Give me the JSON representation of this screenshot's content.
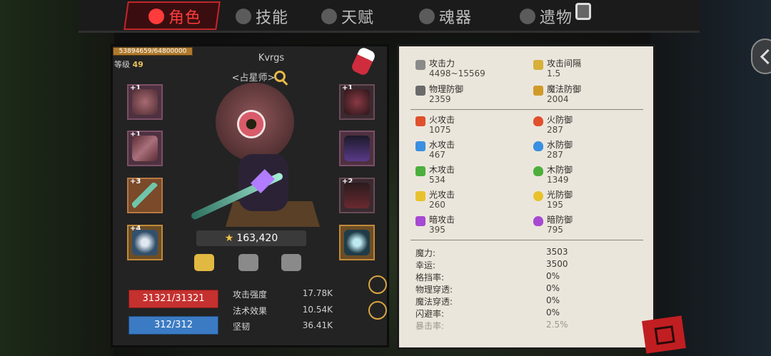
{
  "tabs": [
    {
      "label": "角色",
      "active": true,
      "icon": "demon-face-icon"
    },
    {
      "label": "技能",
      "active": false,
      "icon": "swirl-icon"
    },
    {
      "label": "天赋",
      "active": false,
      "icon": "wings-icon"
    },
    {
      "label": "魂器",
      "active": false,
      "icon": "soul-icon"
    },
    {
      "label": "遗物",
      "active": false,
      "icon": "relic-icon"
    }
  ],
  "character": {
    "xp": "53894659/64800000",
    "xp_fraction": 0.832,
    "level_label": "等级",
    "level": "49",
    "name": "Kvrgs",
    "class": "<占星师>",
    "power": "163,420",
    "hp": "31321/31321",
    "mp": "312/312"
  },
  "equipment_slots": [
    {
      "plus": "+1",
      "item": "bear-head-helmet"
    },
    {
      "plus": "+1",
      "item": "bone-gauntlet"
    },
    {
      "plus": "+3",
      "item": "jade-blade"
    },
    {
      "plus": "+4",
      "item": "skull-amulet"
    },
    {
      "plus": "+1",
      "item": "claw-bracer"
    },
    {
      "plus": "",
      "item": "crystal-armor"
    },
    {
      "plus": "+2",
      "item": "dark-boots"
    },
    {
      "plus": "",
      "item": "spiked-ring"
    }
  ],
  "substats": [
    {
      "label": "攻击强度",
      "value": "17.78K"
    },
    {
      "label": "法术效果",
      "value": "10.54K"
    },
    {
      "label": "坚韧",
      "value": "36.41K"
    }
  ],
  "stats_main": [
    {
      "label": "攻击力",
      "value": "4498~15569",
      "icon": "sword-icon"
    },
    {
      "label": "攻击间隔",
      "value": "1.5",
      "icon": "arrow-icon"
    },
    {
      "label": "物理防御",
      "value": "2359",
      "icon": "shield-sword-icon"
    },
    {
      "label": "魔法防御",
      "value": "2004",
      "icon": "wand-icon"
    }
  ],
  "stats_elements": [
    {
      "label": "火攻击",
      "value": "1075",
      "color": "#e0502c"
    },
    {
      "label": "火防御",
      "value": "287",
      "color": "#e0502c"
    },
    {
      "label": "水攻击",
      "value": "467",
      "color": "#3a8fe0"
    },
    {
      "label": "水防御",
      "value": "287",
      "color": "#3a8fe0"
    },
    {
      "label": "木攻击",
      "value": "534",
      "color": "#4caf3c"
    },
    {
      "label": "木防御",
      "value": "1349",
      "color": "#4caf3c"
    },
    {
      "label": "光攻击",
      "value": "260",
      "color": "#e8c22c"
    },
    {
      "label": "光防御",
      "value": "195",
      "color": "#e8c22c"
    },
    {
      "label": "暗攻击",
      "value": "395",
      "color": "#a64ad2"
    },
    {
      "label": "暗防御",
      "value": "795",
      "color": "#a64ad2"
    }
  ],
  "stats_other": [
    {
      "label": "魔力:",
      "value": "3503"
    },
    {
      "label": "幸运:",
      "value": "3500"
    },
    {
      "label": "格挡率:",
      "value": "0%"
    },
    {
      "label": "物理穿透:",
      "value": "0%"
    },
    {
      "label": "魔法穿透:",
      "value": "0%"
    },
    {
      "label": "闪避率:",
      "value": "0%"
    },
    {
      "label": "暴击率:",
      "value": "2.5%"
    }
  ]
}
